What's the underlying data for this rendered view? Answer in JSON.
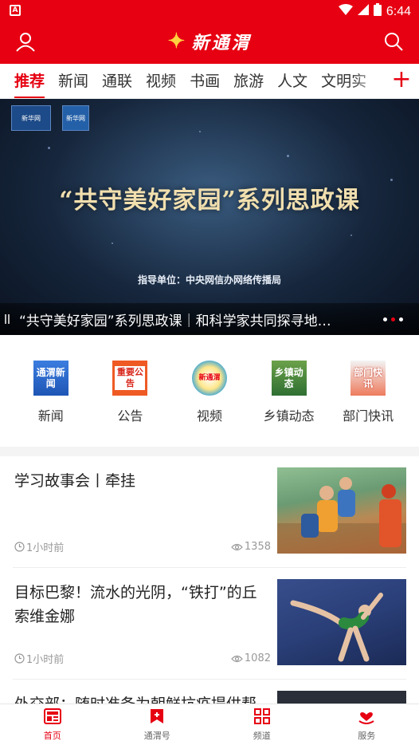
{
  "status_bar": {
    "time": "6:44"
  },
  "header": {
    "logo_text": "新通渭"
  },
  "tabs": [
    {
      "label": "推荐",
      "active": true
    },
    {
      "label": "新闻"
    },
    {
      "label": "通联"
    },
    {
      "label": "视频"
    },
    {
      "label": "书画"
    },
    {
      "label": "旅游"
    },
    {
      "label": "人文"
    },
    {
      "label": "文明实"
    }
  ],
  "banner": {
    "title": "“共守美好家园”系列思政课",
    "guide": "指导单位：中央网信办网络传播局",
    "caption": "“共守美好家园”系列思政课｜和科学家共同探寻地…",
    "active_dot": 2,
    "dot_count": 3
  },
  "quick_nav": [
    {
      "label": "新闻",
      "icon_text": "通渭新闻"
    },
    {
      "label": "公告",
      "icon_text": "重要公告"
    },
    {
      "label": "视频",
      "icon_text": "新通渭"
    },
    {
      "label": "乡镇动态",
      "icon_text": "乡镇动态"
    },
    {
      "label": "部门快讯",
      "icon_text": "部门快讯"
    }
  ],
  "news": [
    {
      "title": "学习故事会丨牵挂",
      "time": "1小时前",
      "views": "1358"
    },
    {
      "title": "目标巴黎！流水的光阴，“铁打”的丘索维金娜",
      "time": "1小时前",
      "views": "1082"
    },
    {
      "title": "外交部：随时准备为朝鲜抗疫提供帮"
    }
  ],
  "bottom_nav": [
    {
      "label": "首页",
      "active": true
    },
    {
      "label": "通渭号"
    },
    {
      "label": "频道"
    },
    {
      "label": "服务"
    }
  ],
  "colors": {
    "brand": "#e60012",
    "accent": "#ffd23f"
  }
}
